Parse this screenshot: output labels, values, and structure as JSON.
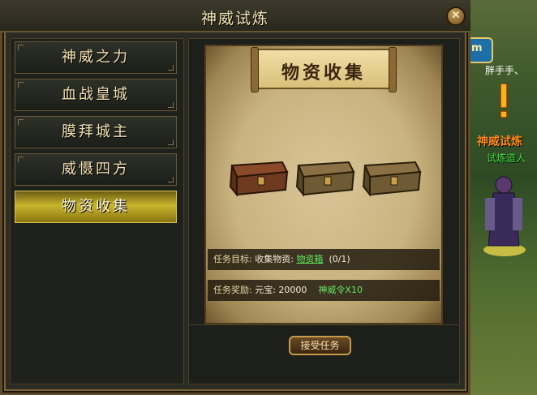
{
  "window": {
    "title": "神威试炼",
    "close_symbol": "✕"
  },
  "menu": {
    "items": [
      {
        "label": "神威之力",
        "active": false
      },
      {
        "label": "血战皇城",
        "active": false
      },
      {
        "label": "膜拜城主",
        "active": false
      },
      {
        "label": "威慑四方",
        "active": false
      },
      {
        "label": "物资收集",
        "active": true
      }
    ]
  },
  "task": {
    "heading": "物资收集",
    "objective_label": "任务目标:",
    "objective_text": "收集物资:",
    "objective_item": "物资箱",
    "objective_progress": "(0/1)",
    "reward_label": "任务奖励:",
    "reward_text": "元宝: 20000",
    "reward_item": "神威令X10",
    "chest_count": 3
  },
  "buttons": {
    "accept_label": "接受任务"
  },
  "world": {
    "banner_text": "m",
    "player_name": "胖手手、",
    "npc_title": "神威试炼",
    "npc_subtitle": "试炼道人"
  },
  "colors": {
    "accent_gold": "#c7b52b",
    "quest_green": "#5fe85f",
    "npc_orange": "#ff8a1a"
  }
}
